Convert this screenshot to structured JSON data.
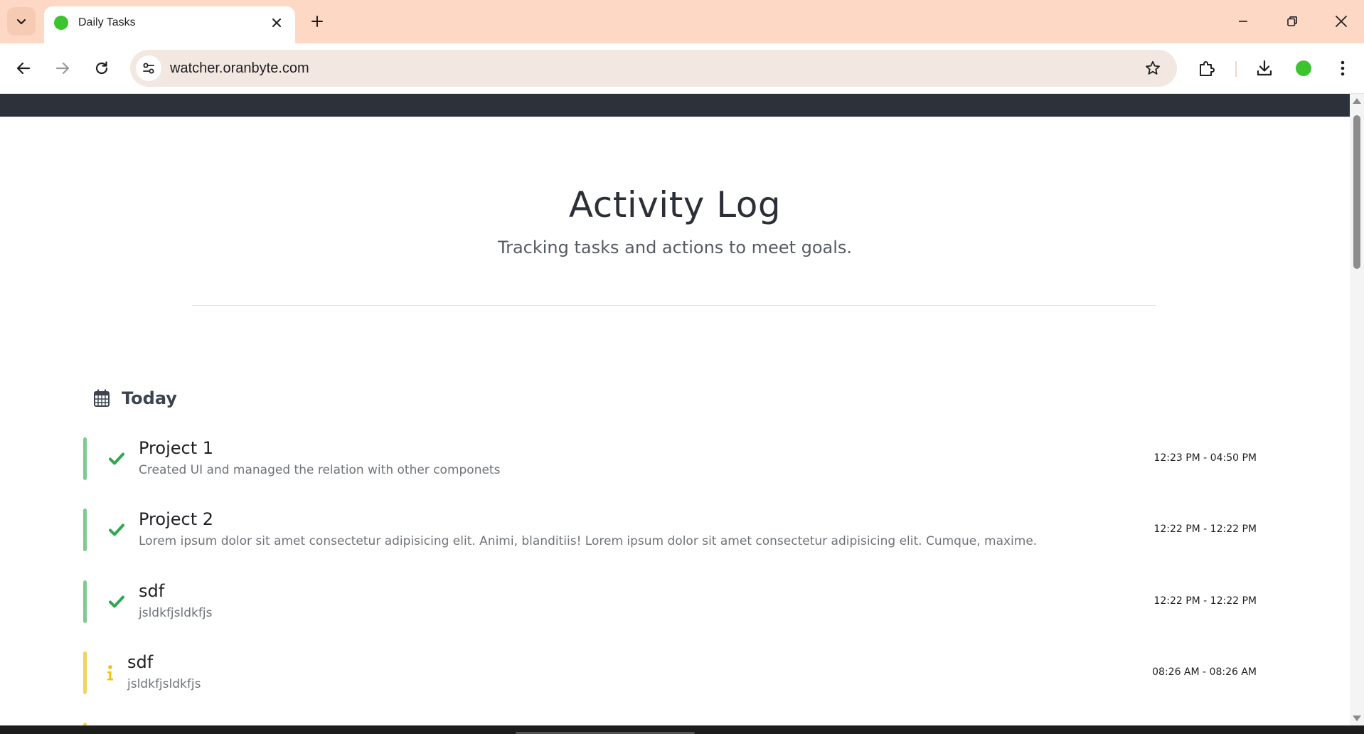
{
  "browser": {
    "tab_title": "Daily Tasks",
    "url": "watcher.oranbyte.com",
    "favicon_color": "#3cc42f",
    "tabbar_color": "#fdd8c4"
  },
  "page": {
    "title": "Activity Log",
    "subtitle": "Tracking tasks and actions to meet goals.",
    "topbar_color": "#2d313a"
  },
  "section": {
    "label": "Today",
    "icon": "calendar-icon"
  },
  "status_colors": {
    "done": "#2fa84f",
    "info": "#f4c20d",
    "done_bar": "#7ccc8e",
    "info_bar": "#f5d35a"
  },
  "entries": [
    {
      "title": "Project 1",
      "description": "Created UI and managed the relation with other componets",
      "time": "12:23 PM - 04:50 PM",
      "status": "done",
      "icon": "check-icon"
    },
    {
      "title": "Project 2",
      "description": "Lorem ipsum dolor sit amet consectetur adipisicing elit. Animi, blanditiis! Lorem ipsum dolor sit amet consectetur adipisicing elit. Cumque, maxime.",
      "time": "12:22 PM - 12:22 PM",
      "status": "done",
      "icon": "check-icon"
    },
    {
      "title": "sdf",
      "description": "jsldkfjsldkfjs",
      "time": "12:22 PM - 12:22 PM",
      "status": "done",
      "icon": "check-icon"
    },
    {
      "title": "sdf",
      "description": "jsldkfjsldkfjs",
      "time": "08:26 AM - 08:26 AM",
      "status": "info",
      "icon": "info-icon"
    }
  ]
}
